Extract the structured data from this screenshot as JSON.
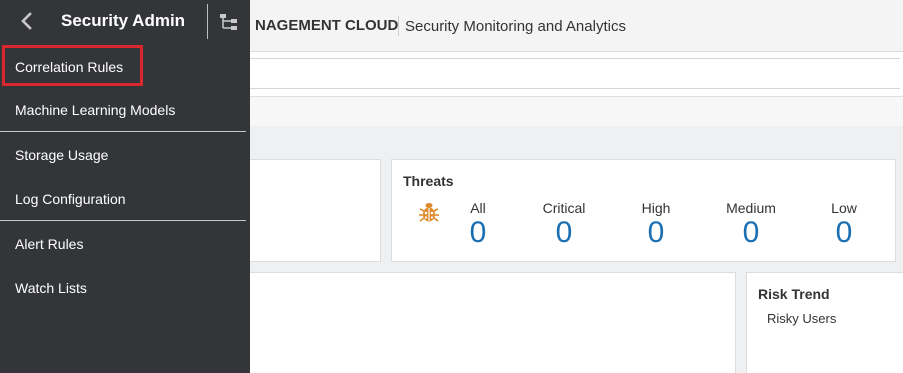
{
  "topbar": {
    "brand": "NAGEMENT CLOUD",
    "subtitle": "Security Monitoring and Analytics"
  },
  "drawer": {
    "title": "Security Admin",
    "back_icon": "chevron-left-icon",
    "tree_icon": "hierarchy-icon",
    "items": [
      {
        "label": "Correlation Rules",
        "highlighted": true
      },
      {
        "label": "Machine Learning Models"
      },
      {
        "label": "Storage Usage"
      },
      {
        "label": "Log Configuration"
      },
      {
        "label": "Alert Rules"
      },
      {
        "label": "Watch Lists"
      }
    ]
  },
  "threats": {
    "title": "Threats",
    "icon": "bug-icon",
    "stats": [
      {
        "label": "All",
        "value": "0"
      },
      {
        "label": "Critical",
        "value": "0"
      },
      {
        "label": "High",
        "value": "0"
      },
      {
        "label": "Medium",
        "value": "0"
      },
      {
        "label": "Low",
        "value": "0"
      }
    ]
  },
  "risk_trend": {
    "title": "Risk Trend",
    "subtitle": "Risky Users"
  },
  "colors": {
    "drawer_bg": "#333538",
    "highlight": "#d9272d",
    "stat_value": "#1a6fb3",
    "bug_orange": "#e08a2c"
  }
}
